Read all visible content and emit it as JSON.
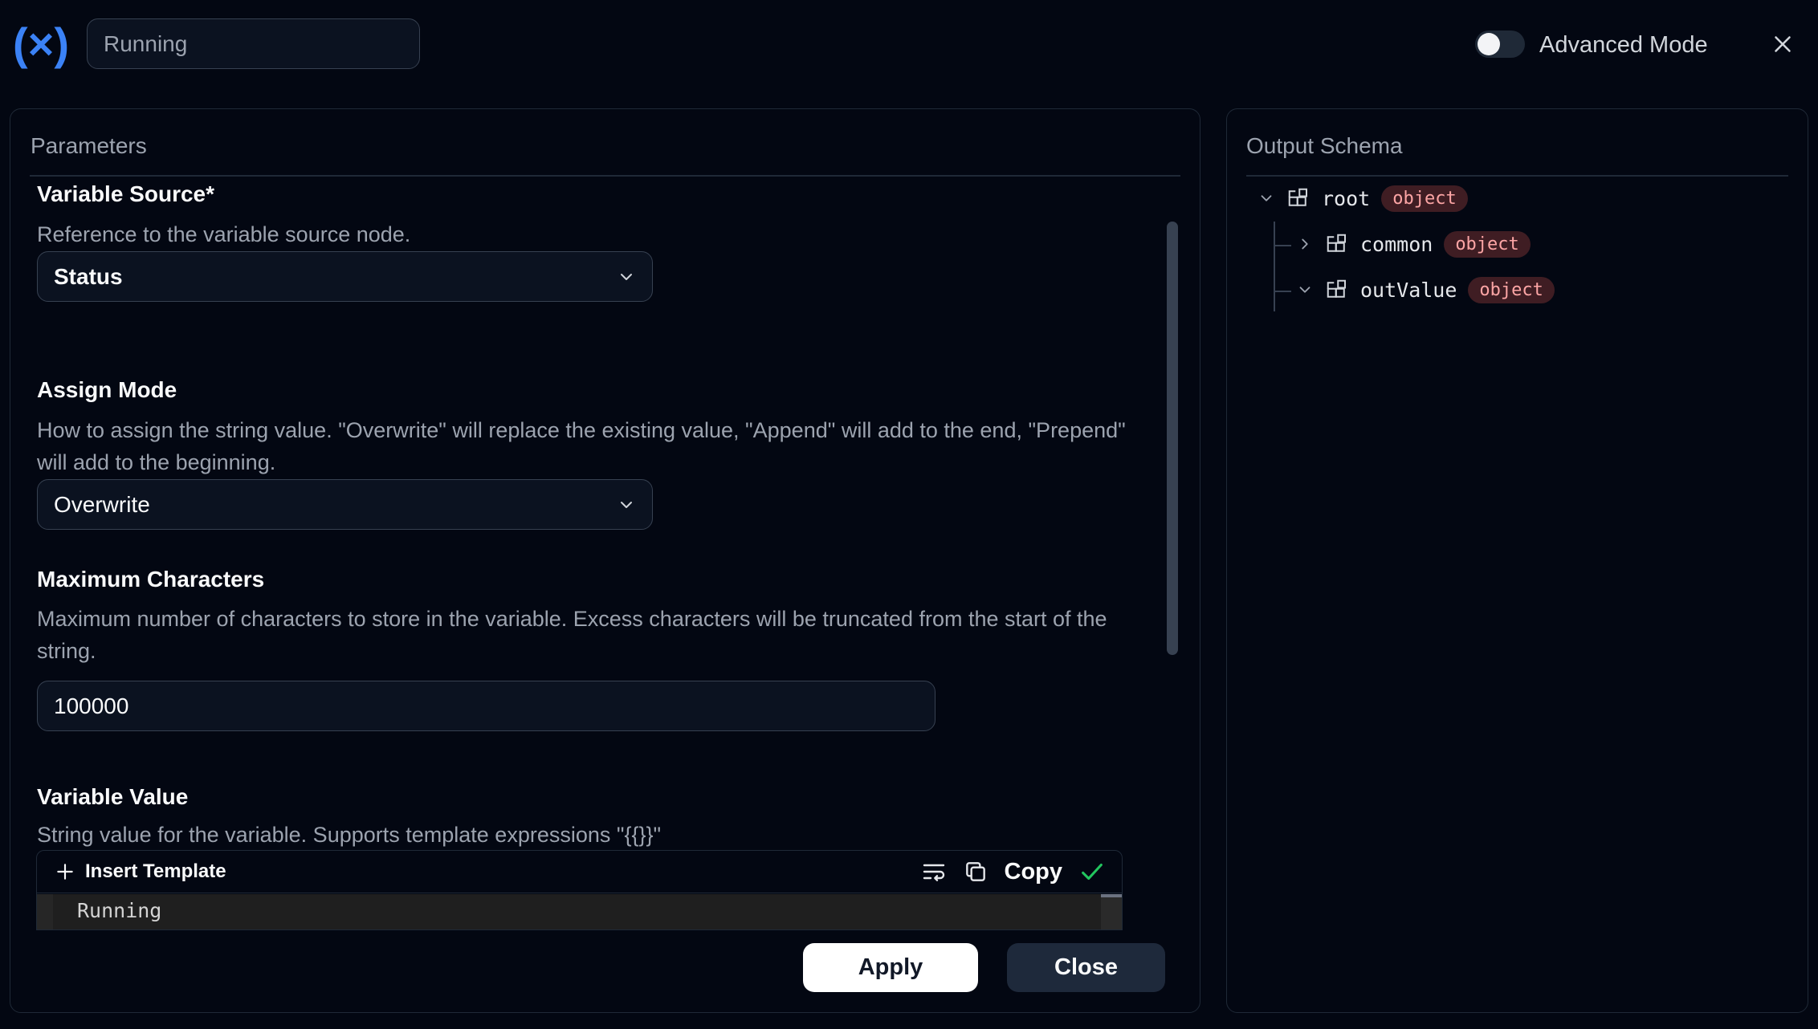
{
  "header": {
    "logo_text": "(×)",
    "name_value": "Running",
    "advanced_mode_label": "Advanced Mode",
    "advanced_mode_on": false
  },
  "parameters": {
    "title": "Parameters",
    "variable_source": {
      "label": "Variable Source*",
      "description": "Reference to the variable source node.",
      "selected": "Status"
    },
    "assign_mode": {
      "label": "Assign Mode",
      "description": "How to assign the string value. \"Overwrite\" will replace the existing value, \"Append\" will add to the end, \"Prepend\" will add to the beginning.",
      "selected": "Overwrite"
    },
    "max_chars": {
      "label": "Maximum Characters",
      "description": "Maximum number of characters to store in the variable. Excess characters will be truncated from the start of the string.",
      "value": "100000"
    },
    "variable_value": {
      "label": "Variable Value",
      "description": "String value for the variable. Supports template expressions \"{{}}\"",
      "insert_template_label": "Insert Template",
      "copy_label": "Copy",
      "editor_text": "Running"
    }
  },
  "actions": {
    "apply_label": "Apply",
    "close_label": "Close"
  },
  "output_schema": {
    "title": "Output Schema",
    "nodes": [
      {
        "name": "root",
        "type": "object",
        "expanded": true
      },
      {
        "name": "common",
        "type": "object",
        "expanded": false
      },
      {
        "name": "outValue",
        "type": "object",
        "expanded": true
      }
    ]
  },
  "colors": {
    "background": "#030712",
    "accent": "#3b82f6",
    "badge_bg": "#3f1d23",
    "badge_text": "#fca5a5",
    "check": "#22c55e"
  }
}
